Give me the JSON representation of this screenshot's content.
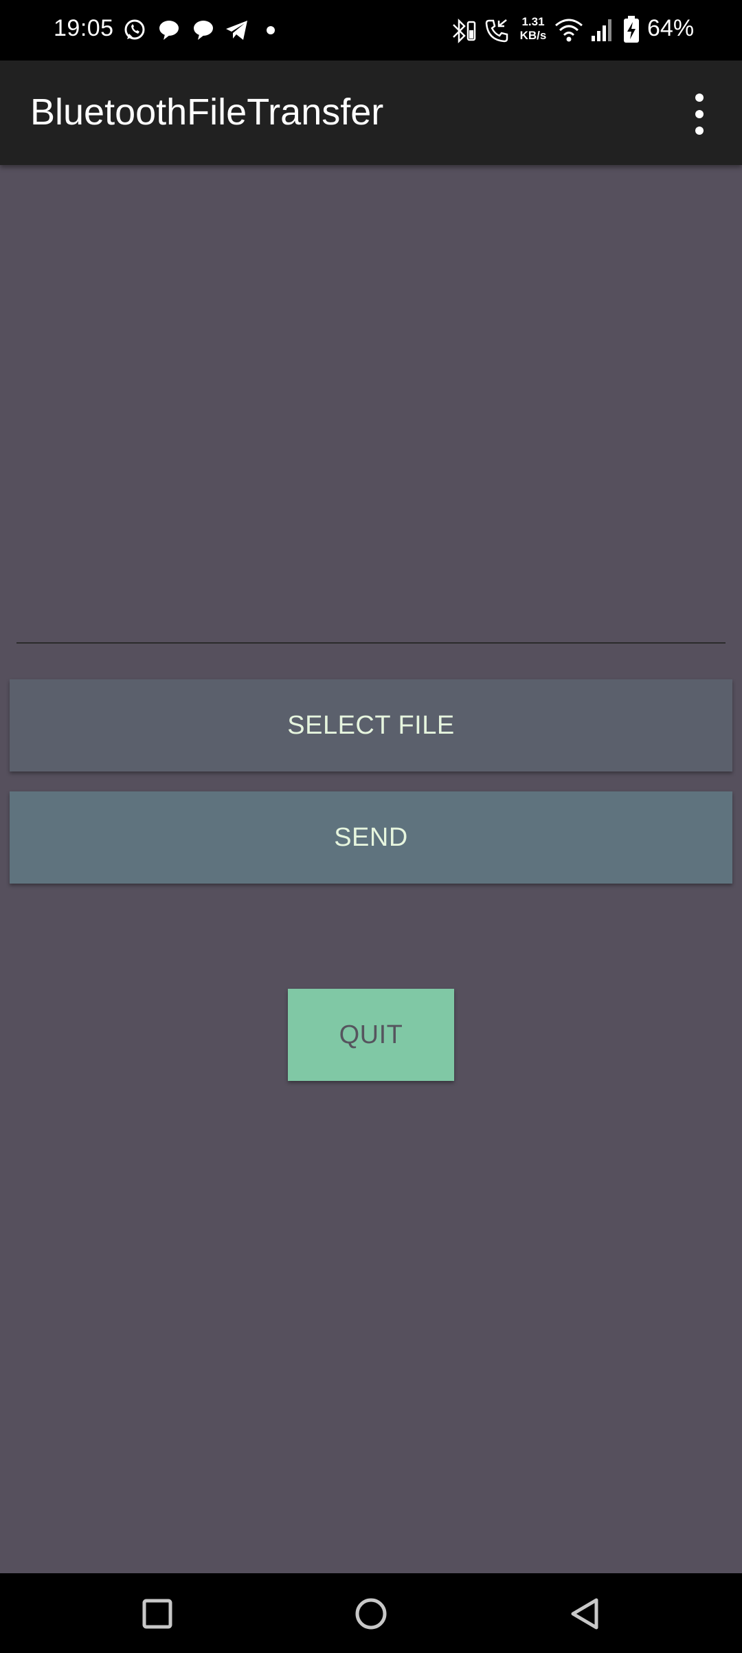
{
  "status_bar": {
    "time": "19:05",
    "notification_icons": [
      "whatsapp-icon",
      "chat-bubble-icon",
      "chat-bubble-icon",
      "telegram-icon",
      "dot-icon"
    ],
    "system_icons": [
      "bluetooth-battery-icon",
      "call-icon",
      "wifi-icon",
      "signal-icon",
      "battery-charging-icon"
    ],
    "network_speed_value": "1.31",
    "network_speed_unit": "KB/s",
    "battery": "64%"
  },
  "app_bar": {
    "title": "BluetoothFileTransfer",
    "menu_icon": "more-vert-icon"
  },
  "main": {
    "file_field_value": "",
    "select_file_label": "SELECT FILE",
    "send_label": "SEND",
    "quit_label": "QUIT"
  },
  "nav_bar": {
    "icons": [
      "recents-icon",
      "home-icon",
      "back-icon"
    ]
  },
  "colors": {
    "background": "#56505d",
    "app_bar": "#212121",
    "select_file_button": "#5b606c",
    "send_button": "#5f737e",
    "quit_button": "#80c8a5",
    "button_text": "#e6f5de"
  }
}
